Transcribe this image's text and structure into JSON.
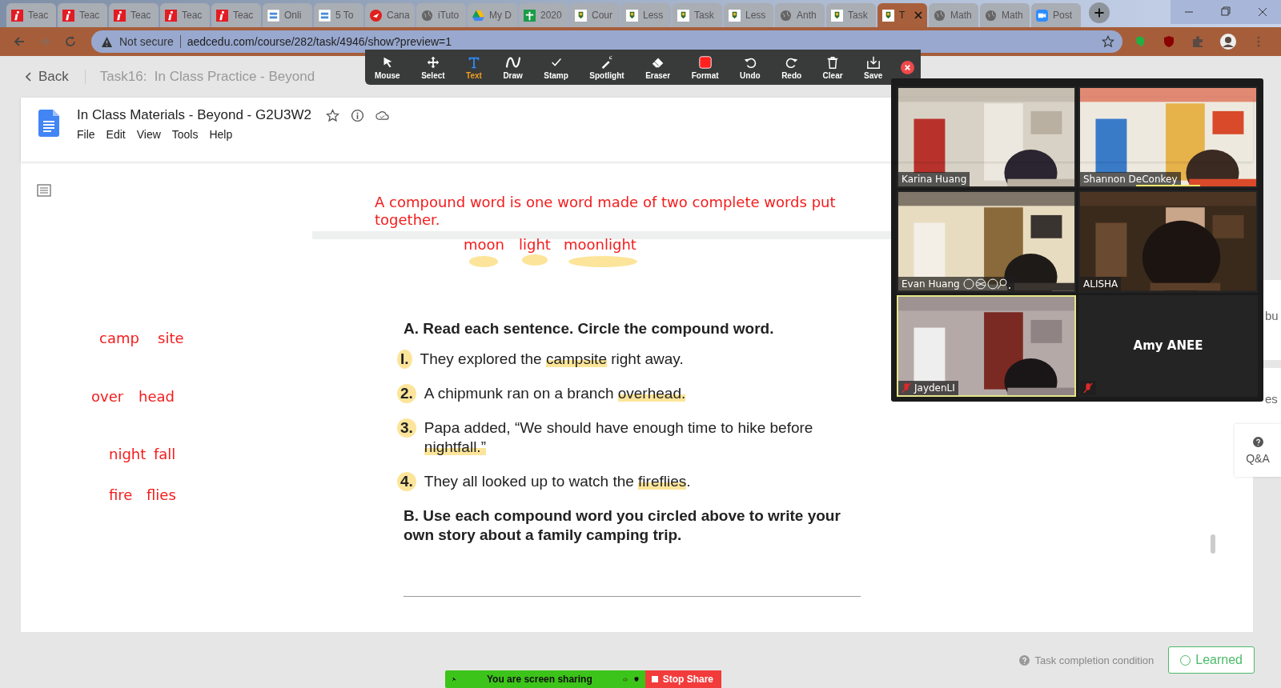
{
  "browser": {
    "tabs": [
      {
        "label": "Teac",
        "kind": "red_i",
        "selected": false
      },
      {
        "label": "Teac",
        "kind": "red_i",
        "selected": false
      },
      {
        "label": "Teac",
        "kind": "red_i",
        "selected": false
      },
      {
        "label": "Teac",
        "kind": "red_i",
        "selected": false
      },
      {
        "label": "Teac",
        "kind": "red_i",
        "selected": false
      },
      {
        "label": "Onli",
        "kind": "oet",
        "selected": false
      },
      {
        "label": "5 To",
        "kind": "oet",
        "selected": false
      },
      {
        "label": "Cana",
        "kind": "post",
        "selected": false
      },
      {
        "label": "iTuto",
        "kind": "globe",
        "selected": false
      },
      {
        "label": "My D",
        "kind": "drive",
        "selected": false
      },
      {
        "label": "2020",
        "kind": "sheets",
        "selected": false
      },
      {
        "label": "Cour",
        "kind": "school",
        "selected": false
      },
      {
        "label": "Less",
        "kind": "school",
        "selected": false
      },
      {
        "label": "Task",
        "kind": "school",
        "selected": false
      },
      {
        "label": "Less",
        "kind": "school",
        "selected": false
      },
      {
        "label": "Anth",
        "kind": "globe",
        "selected": false
      },
      {
        "label": "Task",
        "kind": "school",
        "selected": false
      },
      {
        "label": "T",
        "kind": "school",
        "selected": true
      },
      {
        "label": "Math",
        "kind": "globe",
        "selected": false
      },
      {
        "label": "Math",
        "kind": "globe",
        "selected": false
      },
      {
        "label": "Post",
        "kind": "zoom",
        "selected": false
      }
    ],
    "security": "Not secure",
    "url": "aedcedu.com/course/282/task/4946/show?preview=1"
  },
  "header": {
    "back": "Back",
    "task_title": "Task16:  In Class Practice - Beyond"
  },
  "toolbar": [
    {
      "label": "Mouse",
      "kind": "mouse",
      "selected": false
    },
    {
      "label": "Select",
      "kind": "select",
      "selected": false
    },
    {
      "label": "Text",
      "kind": "text",
      "selected": true
    },
    {
      "label": "Draw",
      "kind": "draw",
      "selected": false
    },
    {
      "label": "Stamp",
      "kind": "stamp",
      "selected": false
    },
    {
      "label": "Spotlight",
      "kind": "spotlight",
      "selected": false
    },
    {
      "label": "Eraser",
      "kind": "eraser",
      "selected": false
    },
    {
      "label": "Format",
      "kind": "format",
      "selected": false,
      "color": "#ff2020"
    },
    {
      "label": "Undo",
      "kind": "undo",
      "selected": false
    },
    {
      "label": "Redo",
      "kind": "redo",
      "selected": false
    },
    {
      "label": "Clear",
      "kind": "clear",
      "selected": false
    },
    {
      "label": "Save",
      "kind": "save",
      "selected": false
    }
  ],
  "document": {
    "title": "In Class Materials - Beyond - G2U3W2",
    "menu": [
      "File",
      "Edit",
      "View",
      "Tools",
      "Help"
    ]
  },
  "annotations": {
    "sentence": "A compound word is one word made of two complete words put together.",
    "words": [
      "moon",
      "light",
      "moonlight",
      "camp",
      "site",
      "over",
      "head",
      "night",
      "fall",
      "fire",
      "flies"
    ]
  },
  "worksheet": {
    "heading_a": "A. Read each sentence. Circle the compound word.",
    "items": [
      {
        "number": "I.",
        "before": "They explored the ",
        "highlight": "campsite",
        "after": " right away."
      },
      {
        "number": "2.",
        "before": "A chipmunk ran on a branch ",
        "highlight": "overhead."
      },
      {
        "number": "3.",
        "before": "Papa added, “We should have enough time to hike before ",
        "highlight": "nightfall.”"
      },
      {
        "number": "4.",
        "before": "They all looked up to watch the ",
        "highlight": "fireflies",
        "after": "."
      }
    ],
    "heading_b": "B. Use each compound word you circled above to write your own story about a family camping trip."
  },
  "video": {
    "participants": [
      {
        "name": "Karina Huang",
        "video": true,
        "muted": false,
        "speaking": false,
        "active_speaker": false,
        "emoji_trail": false
      },
      {
        "name": "Shannon DeConkey",
        "video": true,
        "muted": false,
        "speaking": true,
        "active_speaker": false,
        "emoji_trail": false
      },
      {
        "name": "Evan Huang",
        "video": true,
        "muted": false,
        "speaking": false,
        "active_speaker": false,
        "emoji_trail": true
      },
      {
        "name": "ALISHA",
        "video": true,
        "muted": false,
        "speaking": false,
        "active_speaker": false,
        "emoji_trail": false
      },
      {
        "name": "JaydenLI",
        "video": true,
        "muted": true,
        "speaking": false,
        "active_speaker": true,
        "emoji_trail": false
      },
      {
        "name": "Amy ANEE",
        "video": false,
        "muted": true,
        "speaking": false,
        "active_speaker": false,
        "emoji_trail": false
      }
    ]
  },
  "side_panel": {
    "texts": [
      "bu",
      "es"
    ],
    "qa": "Q&A"
  },
  "footer": {
    "condition": "Task completion condition",
    "learned": "Learned"
  },
  "share_bar": {
    "status": "You are screen sharing",
    "stop": "Stop Share"
  }
}
